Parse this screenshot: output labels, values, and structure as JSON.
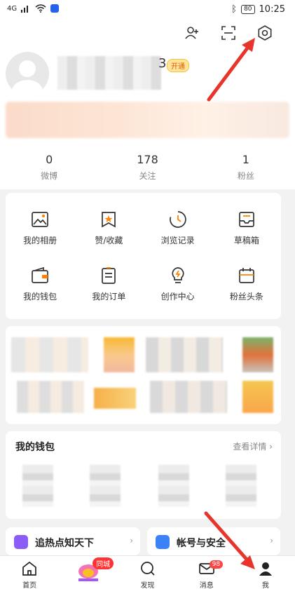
{
  "status_bar": {
    "network": "4G",
    "battery": "80",
    "time": "10:25"
  },
  "profile": {
    "name_tail": "3",
    "vip_label": "开通"
  },
  "stats": [
    {
      "value": "0",
      "label": "微博"
    },
    {
      "value": "178",
      "label": "关注"
    },
    {
      "value": "1",
      "label": "粉丝"
    }
  ],
  "features": [
    {
      "label": "我的相册",
      "icon": "album-icon"
    },
    {
      "label": "赞/收藏",
      "icon": "favorite-icon"
    },
    {
      "label": "浏览记录",
      "icon": "history-icon"
    },
    {
      "label": "草稿箱",
      "icon": "drafts-icon"
    },
    {
      "label": "我的钱包",
      "icon": "wallet-icon"
    },
    {
      "label": "我的订单",
      "icon": "orders-icon"
    },
    {
      "label": "创作中心",
      "icon": "creator-icon"
    },
    {
      "label": "粉丝头条",
      "icon": "fans-headline-icon"
    }
  ],
  "wallet": {
    "title": "我的钱包",
    "more": "查看详情"
  },
  "bottom_cards": [
    {
      "title": "追热点知天下",
      "color": "#8b5cf6"
    },
    {
      "title": "帐号与安全",
      "color": "#3b82f6"
    }
  ],
  "tabbar": {
    "home": "首页",
    "city_badge": "同城",
    "discover": "发现",
    "messages": "消息",
    "messages_badge": "98",
    "me": "我"
  },
  "colors": {
    "accent": "#ff8200",
    "badge": "#ff3333",
    "annotation_arrow": "#e8352b"
  }
}
